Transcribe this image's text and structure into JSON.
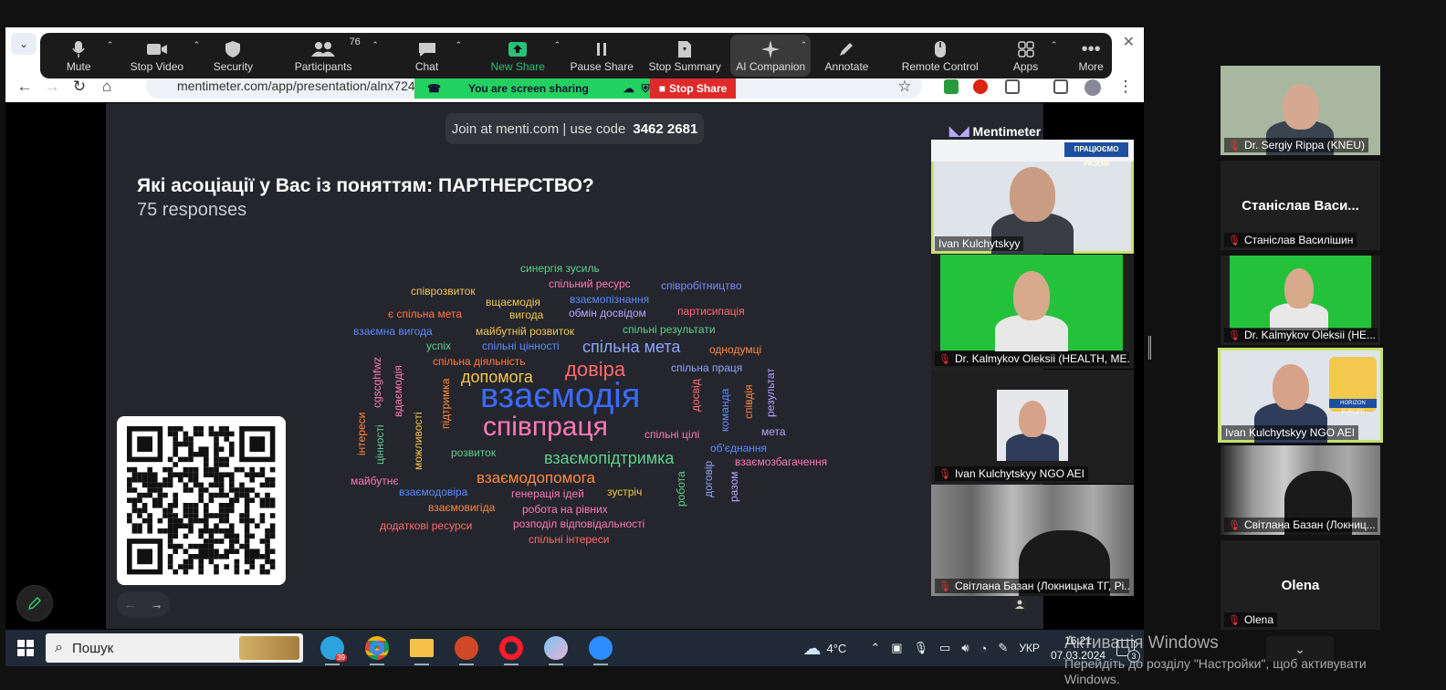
{
  "toolbar": {
    "mute": "Mute",
    "stop_video": "Stop Video",
    "security": "Security",
    "participants": "Participants",
    "participants_count": "76",
    "chat": "Chat",
    "new_share": "New Share",
    "pause_share": "Pause Share",
    "stop_summary": "Stop Summary",
    "ai_companion": "AI Companion",
    "annotate": "Annotate",
    "remote_control": "Remote Control",
    "apps": "Apps",
    "more": "More"
  },
  "browser": {
    "url": "mentimeter.com/app/presentation/alnx724"
  },
  "sharing": {
    "status": "You are screen sharing",
    "stop": "Stop Share"
  },
  "slide": {
    "join_text": "Join at menti.com | use code",
    "code": "3462 2681",
    "brand": "Mentimeter",
    "question": "Які асоціації у Вас із поняттям: ПАРТНЕРСТВО?",
    "responses": "75 responses"
  },
  "wordcloud": {
    "w1": "синергія зусиль",
    "w2": "співрозвиток",
    "w3": "спільний ресурс",
    "w4": "співробітництво",
    "w5": "вщаємодія",
    "w6": "взаємопізнання",
    "w7": "є спільна мета",
    "w8": "вигода",
    "w9": "обмін досвідом",
    "w10": "партисипація",
    "w11": "взаємна вигода",
    "w12": "майбутній розвиток",
    "w13": "спільні результати",
    "w14": "успіх",
    "w15": "спільні цінності",
    "w16": "спільна мета",
    "w17": "однодумці",
    "w18": "спільна діяльність",
    "w19": "спільна праця",
    "w20": "допомога",
    "w21": "довіра",
    "w22": "взаємодія",
    "w23": "співпраця",
    "w24": "спільні цілі",
    "w25": "мета",
    "w26": "розвиток",
    "w27": "взаємопідтримка",
    "w28": "об'єднання",
    "w29": "взаємозбагачення",
    "w30": "майбутнє",
    "w31": "взаємодопомога",
    "w32": "взаємодовіра",
    "w33": "генерація ідей",
    "w34": "зустріч",
    "w35": "взаємовигіда",
    "w36": "робота на рівних",
    "w37": "додаткові ресурси",
    "w38": "розподіл відповідальності",
    "w39": "спільні інтереси",
    "v1": "cgscghfwz",
    "v2": "вдаємодія",
    "v3": "інтереси",
    "v4": "цінності",
    "v5": "можливості",
    "v6": "підтримка",
    "v7": "досвід",
    "v8": "команда",
    "v9": "співдія",
    "v10": "результат",
    "v11": "робота",
    "v12": "договір",
    "v13": "разом"
  },
  "colors": {
    "slide_bg": "#24252d",
    "zoom_green": "#23d160",
    "zoom_red": "#e02a2a",
    "tile_highlight": "#c9e06a",
    "taskbar": "#1f2a36"
  },
  "participants": {
    "main_1": "Ivan Kulchytskyy",
    "main_1_banner": "ПРАЦЮЄМО РАЗОМ",
    "main_2": "Dr. Kalmykov Oleksii (HEALTH, ME...",
    "main_3": "Ivan Kulchytskyy NGO AEI",
    "main_4": "Світлана Базан (Локницька ТГ, Рі...",
    "side_1": "Dr. Sergiy Rippa (KNEU)",
    "side_2_big": "Станіслав Васи...",
    "side_2": "Станіслав Василішин",
    "side_3": "Dr. Kalmykov Oleksii (HE...",
    "side_4": "Ivan Kulchytskyy NGO AEI",
    "side_4_badge": "HORIZON EUROPE",
    "side_5": "Світлана Базан (Локниц...",
    "side_6_big": "Olena",
    "side_6": "Olena"
  },
  "taskbar": {
    "search": "Пошук",
    "telegram_badge": "39",
    "weather": "4°C",
    "lang": "УКР",
    "time": "16:21",
    "date": "07.03.2024",
    "notifications": "3"
  },
  "watermark": {
    "line1": "Активація Windows",
    "line2": "Перейдіть до розділу \"Настройки\", щоб активувати",
    "line3": "Windows."
  }
}
